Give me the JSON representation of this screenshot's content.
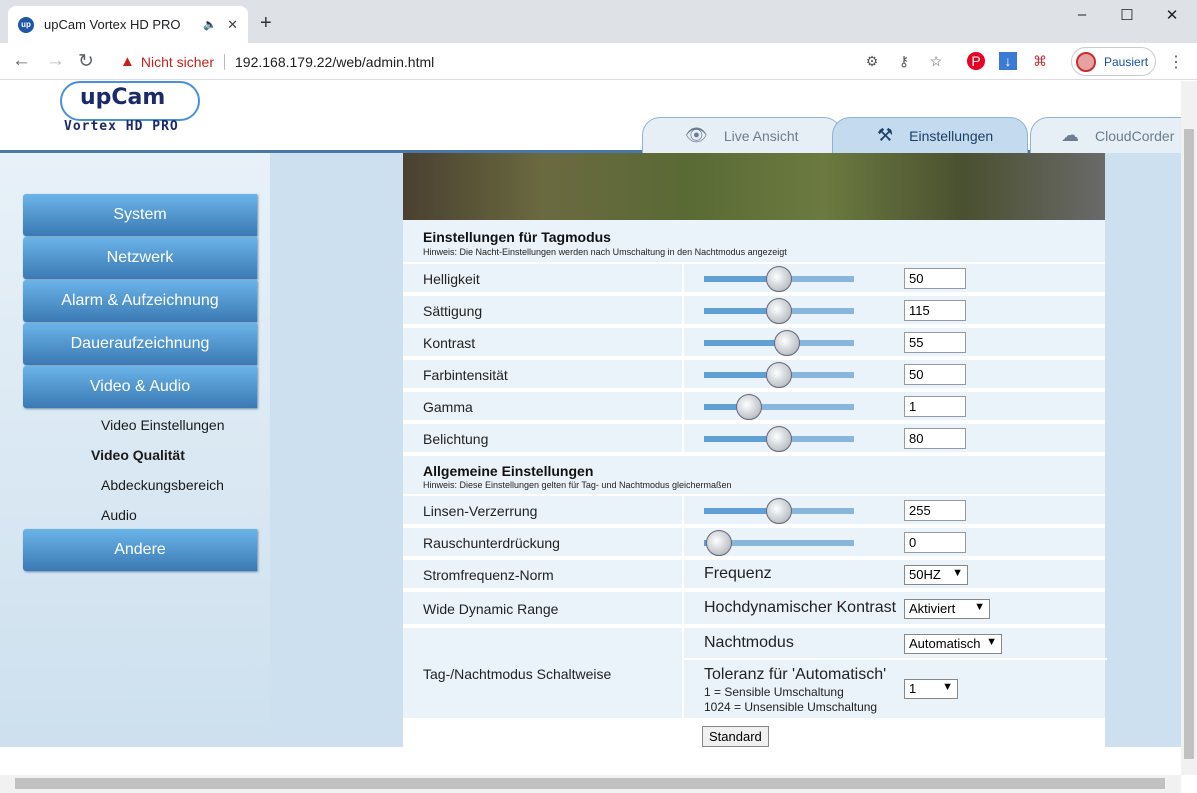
{
  "browser": {
    "tab_title": "upCam Vortex HD PRO",
    "favicon_text": "up",
    "security_label": "Nicht sicher",
    "url": "192.168.179.22/web/admin.html",
    "profile_label": "Pausiert"
  },
  "header": {
    "logo_name": "upCam",
    "logo_sub": "Vortex HD PRO",
    "tabs": [
      {
        "label": "Live Ansicht"
      },
      {
        "label": "Einstellungen"
      },
      {
        "label": "CloudCorder"
      }
    ]
  },
  "sidebar": {
    "buttons": [
      "System",
      "Netzwerk",
      "Alarm & Aufzeichnung",
      "Daueraufzeichnung",
      "Video & Audio",
      "Andere"
    ],
    "subitems": [
      "Video Einstellungen",
      "Video Qualität",
      "Abdeckungsbereich",
      "Audio"
    ]
  },
  "day": {
    "title": "Einstellungen für Tagmodus",
    "hint": "Hinweis: Die Nacht-Einstellungen werden nach Umschaltung in den Nachtmodus angezeigt",
    "rows": [
      {
        "label": "Helligkeit",
        "value": "50",
        "level": 0.5
      },
      {
        "label": "Sättigung",
        "value": "115",
        "level": 0.5
      },
      {
        "label": "Kontrast",
        "value": "55",
        "level": 0.55
      },
      {
        "label": "Farbintensität",
        "value": "50",
        "level": 0.5
      },
      {
        "label": "Gamma",
        "value": "1",
        "level": 0.3
      },
      {
        "label": "Belichtung",
        "value": "80",
        "level": 0.5
      }
    ]
  },
  "general": {
    "title": "Allgemeine Einstellungen",
    "hint": "Hinweis: Diese Einstellungen gelten für Tag- und Nachtmodus gleichermaßen",
    "rows": [
      {
        "label": "Linsen-Verzerrung",
        "value": "255",
        "level": 0.5
      },
      {
        "label": "Rauschunterdrückung",
        "value": "0",
        "level": 0.1
      }
    ],
    "powerfreq": {
      "label": "Stromfrequenz-Norm",
      "sublabel": "Frequenz",
      "value": "50HZ"
    },
    "wdr": {
      "label": "Wide Dynamic Range",
      "sublabel": "Hochdynamischer Kontrast",
      "value": "Aktiviert"
    },
    "daynight": {
      "label": "Tag-/Nachtmodus Schaltweise",
      "night_label": "Nachtmodus",
      "night_value": "Automatisch",
      "tol_label": "Toleranz für 'Automatisch'",
      "tol_line1": "1 = Sensible Umschaltung",
      "tol_line2": "1024 = Unsensible Umschaltung",
      "tol_value": "1"
    },
    "default_button": "Standard"
  }
}
